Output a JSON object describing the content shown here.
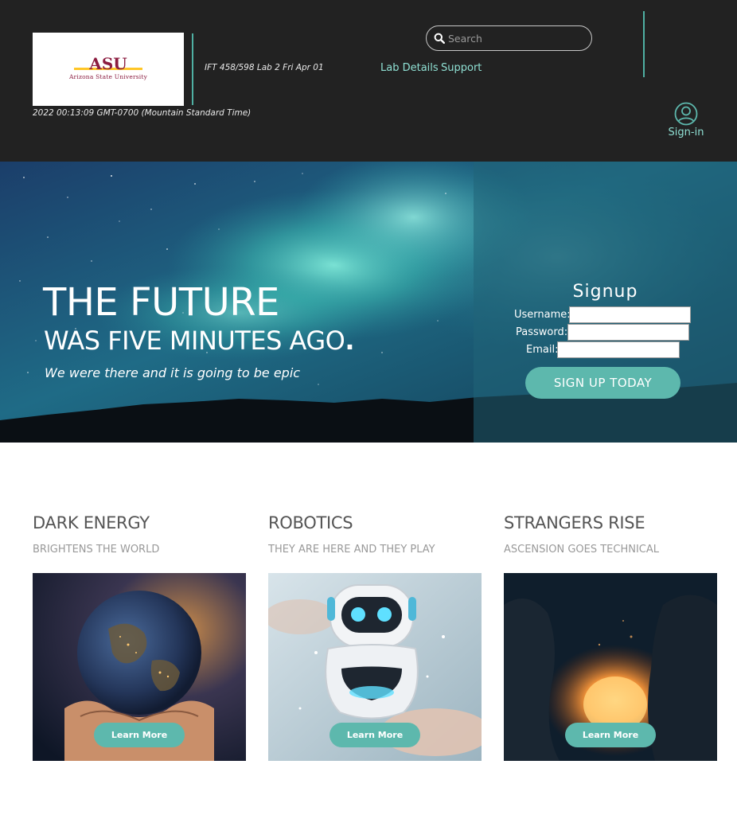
{
  "header": {
    "logo": {
      "mark": "ASU",
      "name": "Arizona State University"
    },
    "lab_info": "IFT 458/598 Lab 2 Fri Apr 01",
    "datetime": "2022 00:13:09 GMT-0700 (Mountain Standard Time)",
    "search": {
      "placeholder": "Search",
      "icon": "search-icon"
    },
    "nav": [
      {
        "label": "Lab Details"
      },
      {
        "label": "Support"
      }
    ],
    "signin": {
      "label": "Sign-in",
      "icon": "user-circle-icon"
    }
  },
  "hero": {
    "title_line1": "THE FUTURE",
    "title_line2": "WAS FIVE MINUTES AGO",
    "title_dot": ".",
    "tagline": "We were there and it is going to be epic"
  },
  "signup": {
    "title": "Signup",
    "fields": [
      {
        "label": "Username:",
        "value": ""
      },
      {
        "label": "Password:",
        "value": ""
      },
      {
        "label": "Email:",
        "value": ""
      }
    ],
    "button": "SIGN UP TODAY"
  },
  "cards": [
    {
      "title": "DARK ENERGY",
      "subtitle": "BRIGHTENS THE WORLD",
      "button": "Learn More",
      "image": "earth-in-hands"
    },
    {
      "title": "ROBOTICS",
      "subtitle": "THEY ARE HERE AND THEY PLAY",
      "button": "Learn More",
      "image": "robot"
    },
    {
      "title": "STRANGERS RISE",
      "subtitle": "ASCENSION GOES TECHNICAL",
      "button": "Learn More",
      "image": "campfire"
    }
  ],
  "colors": {
    "header_bg": "#222222",
    "accent": "#5db8ad",
    "nav_text": "#8fe0d3",
    "asu_maroon": "#8c1d40",
    "asu_gold": "#ffc627"
  }
}
